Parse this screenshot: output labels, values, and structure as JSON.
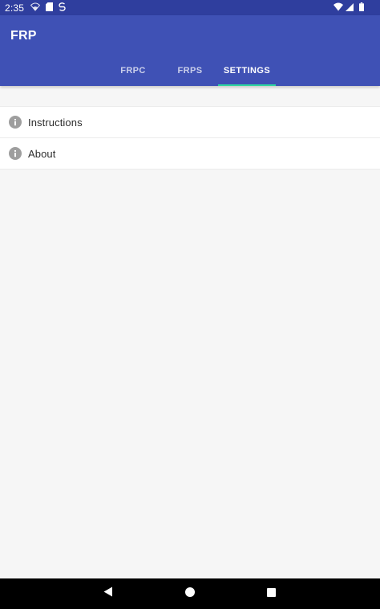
{
  "status_bar": {
    "time": "2:35",
    "left_icons": [
      "wifi-calling-icon",
      "sd-card-icon",
      "sync-icon"
    ],
    "right_icons": [
      "wifi-icon",
      "cell-signal-icon",
      "battery-icon"
    ]
  },
  "app_bar": {
    "title": "FRP",
    "background_color": "#3f51b5",
    "status_color": "#2f3e9e"
  },
  "tabs": [
    {
      "label": "FRPC",
      "selected": false
    },
    {
      "label": "FRPS",
      "selected": false
    },
    {
      "label": "SETTINGS",
      "selected": true
    }
  ],
  "tab_indicator_color": "#2fd6a0",
  "settings_list": [
    {
      "label": "Instructions",
      "icon": "info-icon"
    },
    {
      "label": "About",
      "icon": "info-icon"
    }
  ],
  "nav_bar": {
    "buttons": [
      "back-icon",
      "home-icon",
      "recents-icon"
    ]
  }
}
